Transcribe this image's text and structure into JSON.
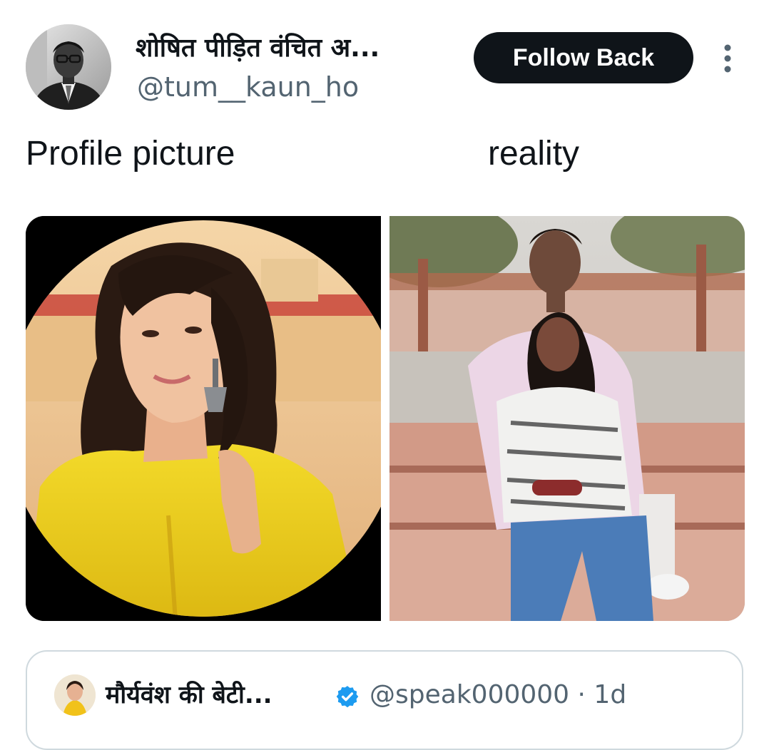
{
  "author": {
    "display_name": "शोषित पीड़ित वंचित अ...",
    "handle": "@tum__kaun_ho"
  },
  "actions": {
    "follow_label": "Follow Back",
    "more_icon": "more-vertical-icon"
  },
  "post": {
    "caption_left": "Profile picture",
    "caption_right": "reality"
  },
  "quoted": {
    "display_name": "मौर्यवंश की बेटी...",
    "verified_icon": "verified-badge-icon",
    "handle": "@speak000000",
    "separator": "·",
    "time": "1d",
    "meta": "@speak000000 · 1d"
  },
  "colors": {
    "button_bg": "#0f1419",
    "secondary_text": "#536471",
    "verified": "#1d9bf0",
    "card_border": "#cfd9de"
  }
}
